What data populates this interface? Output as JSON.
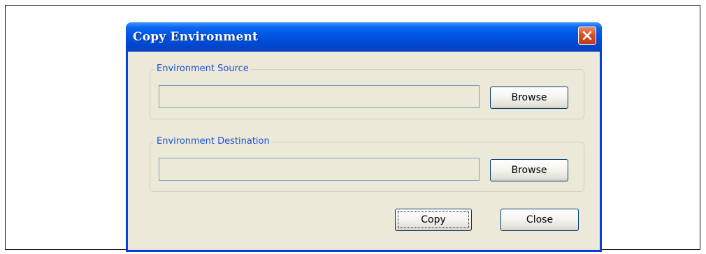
{
  "window": {
    "title": "Copy Environment"
  },
  "source": {
    "legend": "Environment Source",
    "value": "",
    "browse_label": "Browse"
  },
  "destination": {
    "legend": "Environment Destination",
    "value": "",
    "browse_label": "Browse"
  },
  "actions": {
    "copy_label": "Copy",
    "close_label": "Close"
  },
  "colors": {
    "titlebar": "#0054E3",
    "dialog_bg": "#ECE9D8",
    "legend_text": "#1E4FD7",
    "close_red": "#D8502A"
  }
}
